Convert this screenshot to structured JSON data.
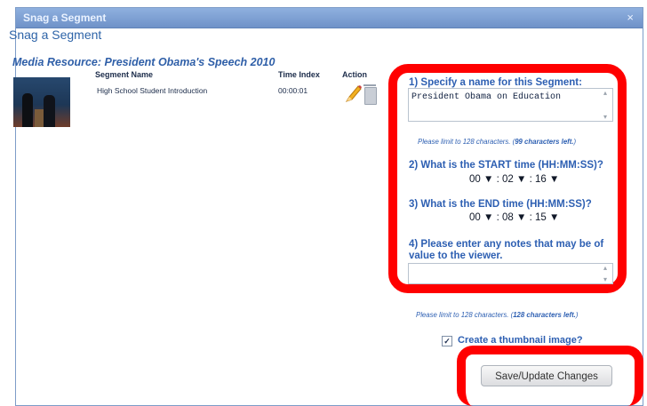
{
  "window": {
    "title": "Snag a Segment",
    "close_glyph": "×"
  },
  "heading": "Snag a Segment",
  "media_resource": "Media Resource: President Obama's Speech 2010",
  "table": {
    "headers": {
      "segment_name": "Segment Name",
      "time_index": "Time Index",
      "action": "Action"
    },
    "rows": [
      {
        "segment_name": "High School Student Introduction",
        "time_index": "00:00:01"
      }
    ]
  },
  "form": {
    "q1": "1) Specify a name for this Segment:",
    "name_value": "President Obama on Education",
    "name_hint_pre": "Please limit to 128 characters. (",
    "name_hint_count": "99 characters left.",
    "name_hint_post": ")",
    "q2": "2) What is the START time (HH:MM:SS)?",
    "start": {
      "hh": "00",
      "mm": "02",
      "ss": "16"
    },
    "q3": "3) What is the END time (HH:MM:SS)?",
    "end": {
      "hh": "00",
      "mm": "08",
      "ss": "15"
    },
    "q4": "4) Please enter any notes that may be of value to the viewer.",
    "notes_value": "",
    "notes_hint_pre": "Please limit to 128 characters. (",
    "notes_hint_count": "128 characters left.",
    "notes_hint_post": ")",
    "thumbnail_label": "Create a thumbnail image?",
    "thumbnail_checked": true
  },
  "save_button": "Save/Update Changes",
  "icons": {
    "edit": "pencil-icon",
    "delete": "trash-icon",
    "dropdown": "triangle-down-icon"
  },
  "colors": {
    "highlight": "#ff0000",
    "link_blue": "#2d5fb2",
    "titlebar": "#7b9dd2"
  }
}
